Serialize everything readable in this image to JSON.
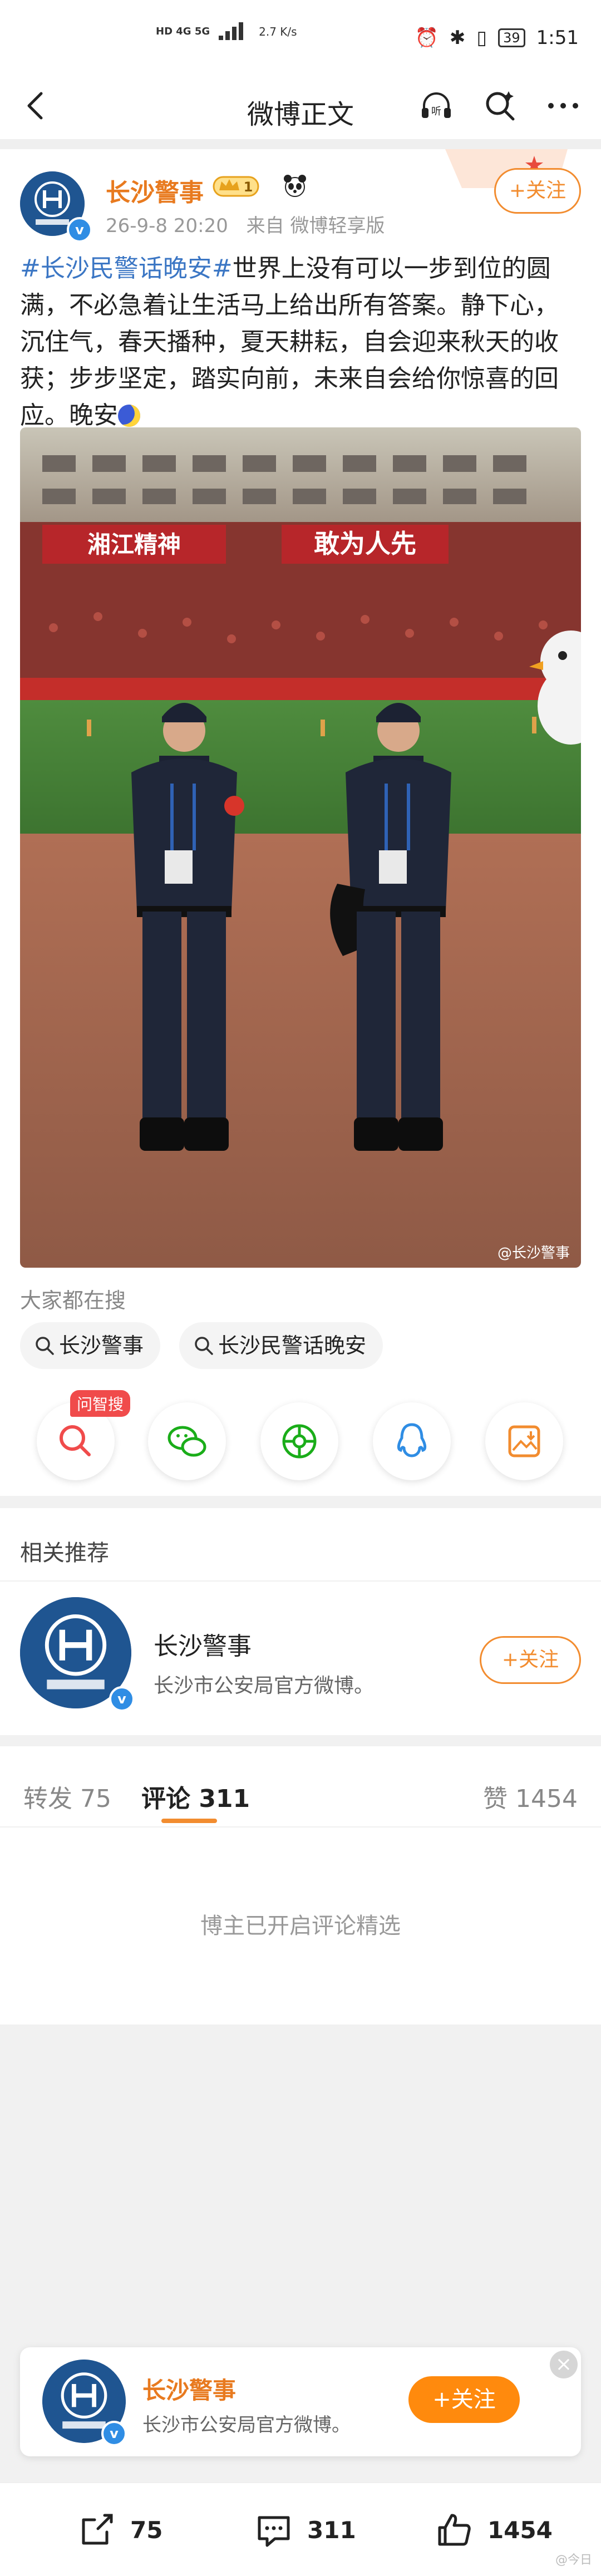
{
  "status_bar": {
    "network": "HD 4G 5G",
    "speed": "2.7 K/s",
    "battery": "39",
    "time": "1:51"
  },
  "nav": {
    "title": "微博正文"
  },
  "post": {
    "author": "长沙警事",
    "vip_level": "1",
    "time": "26-9-8 20:20",
    "source": "来自 微博轻享版",
    "follow_label": "+关注",
    "topic": "#长沙民警话晚安#",
    "text": "世界上没有可以一步到位的圆满，不必急着让生活马上给出所有答案。静下心，沉住气，春天播种，夏天耕耘，自会迎来秋天的收获；步步坚定，踏实向前，未来自会给你惊喜的回应。晚安",
    "image_watermark": "@长沙警事",
    "banner_left": "湘江精神",
    "banner_right": "敢为人先"
  },
  "hot_search": {
    "title": "大家都在搜",
    "chips": [
      "长沙警事",
      "长沙民警话晚安"
    ]
  },
  "share": {
    "ai_tag": "问智搜"
  },
  "related": {
    "title": "相关推荐",
    "name": "长沙警事",
    "desc": "长沙市公安局官方微博。",
    "follow_label": "+关注"
  },
  "tabs": {
    "repost": "转发 75",
    "comment": "评论 311",
    "like": "赞 1454",
    "note": "博主已开启评论精选"
  },
  "float_card": {
    "name": "长沙警事",
    "desc": "长沙市公安局官方微博。",
    "follow_label": "+关注",
    "close": "×"
  },
  "bottom_bar": {
    "repost_count": "75",
    "comment_count": "311",
    "like_count": "1454",
    "site_mark": "@今日"
  },
  "colors": {
    "accent": "#f28c2f",
    "link": "#3b76c4",
    "verified": "#2f8de4"
  }
}
